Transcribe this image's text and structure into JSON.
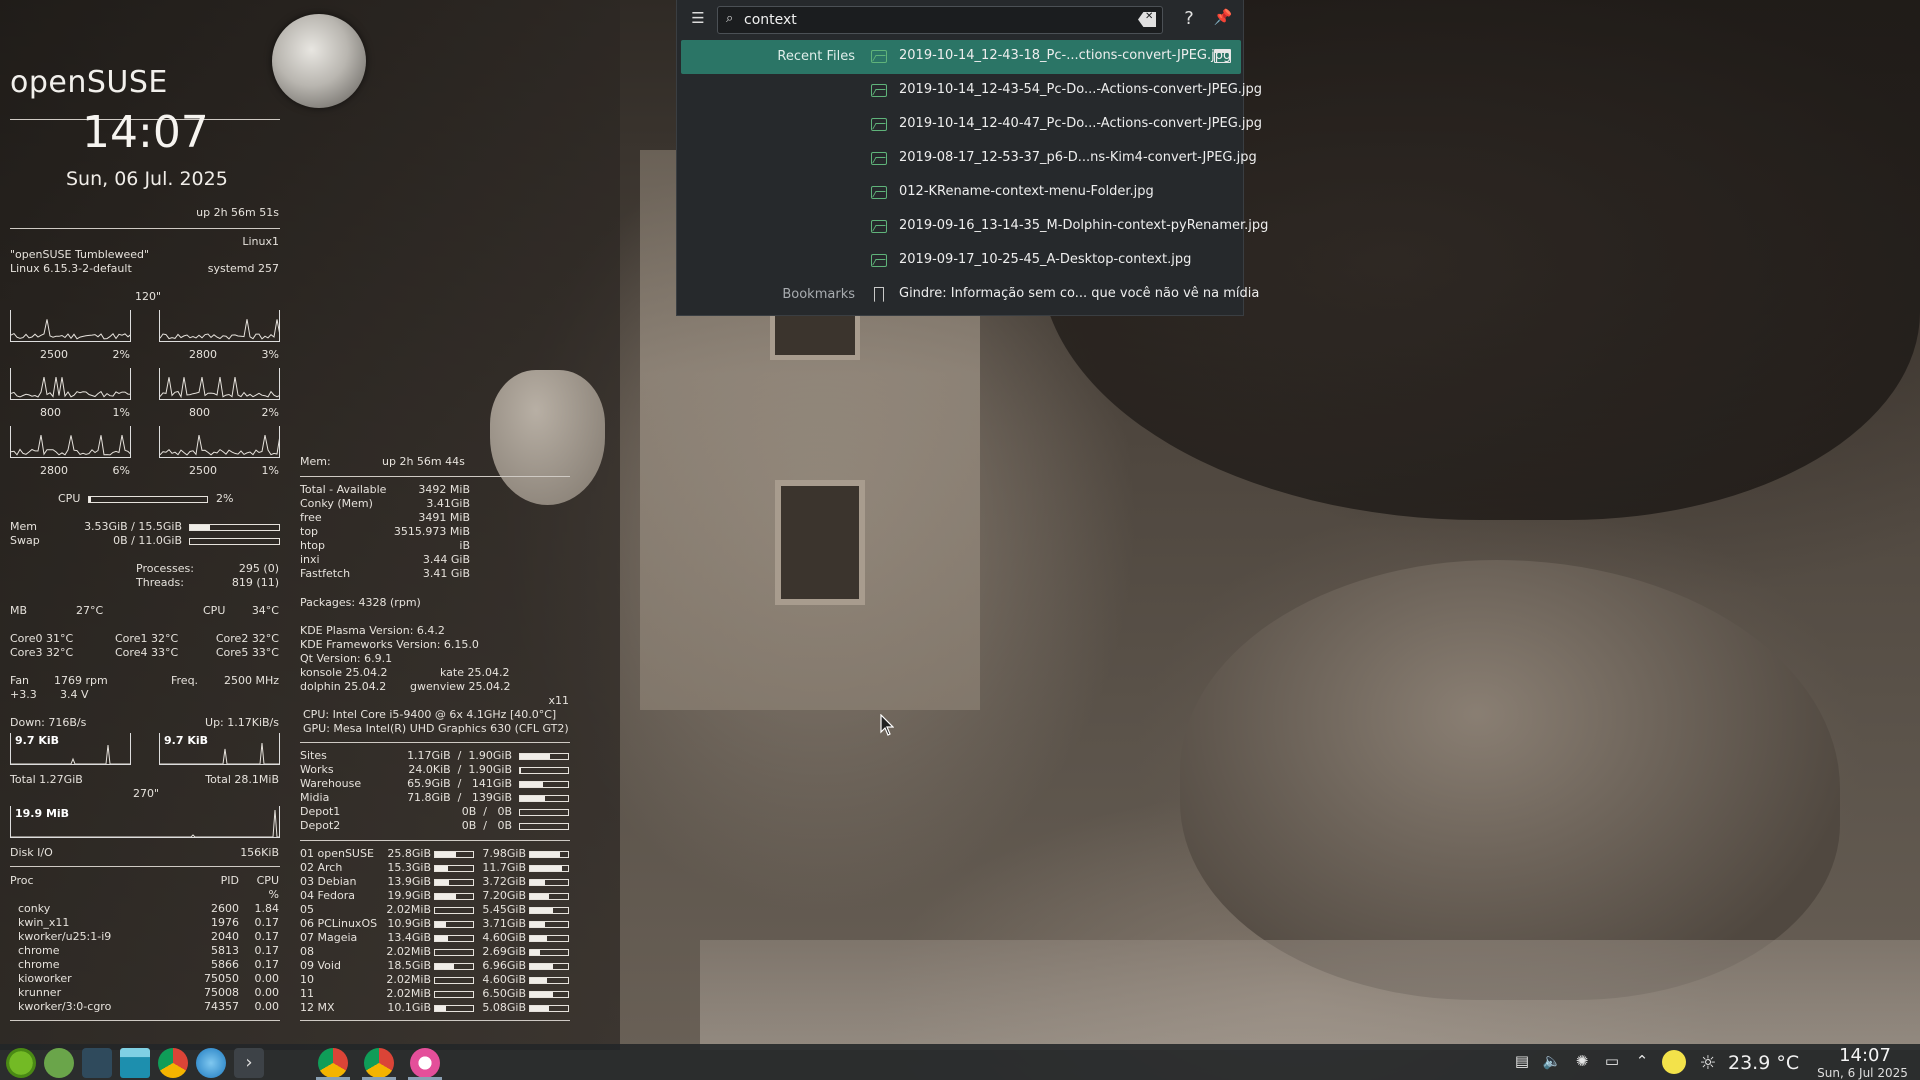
{
  "conky_left": {
    "distro": "openSUSE",
    "time": "14:07",
    "date": "Sun, 06 Jul. 2025",
    "uptime": "up  2h 56m 51s",
    "host": "Linux1",
    "os_name": "\"openSUSE Tumbleweed\"",
    "kernel": "Linux 6.15.3-2-default",
    "systemd": "systemd 257",
    "cpu_interval": "120\"",
    "cores": [
      {
        "freq": "2500",
        "usage": "2%"
      },
      {
        "freq": "2800",
        "usage": "3%"
      },
      {
        "freq": "800",
        "usage": "1%"
      },
      {
        "freq": "800",
        "usage": "2%"
      },
      {
        "freq": "2800",
        "usage": "6%"
      },
      {
        "freq": "2500",
        "usage": "1%"
      }
    ],
    "cpu_label": "CPU",
    "cpu_total": "2%",
    "cpu_fraction": 0.02,
    "mem_label": "Mem",
    "mem_value": "3.53GiB / 15.5GiB",
    "mem_fraction": 0.23,
    "swap_label": "Swap",
    "swap_value": "0B / 11.0GiB",
    "swap_fraction": 0.0,
    "processes_label": "Processes:",
    "processes": "295 (0)",
    "threads_label": "Threads:",
    "threads": "819 (11)",
    "mb_label": "MB",
    "mb_temp": "27°C",
    "cpu_temp_label": "CPU",
    "cpu_temp": "34°C",
    "core_temps": [
      "Core0  31°C",
      "Core1  32°C",
      "Core2  32°C",
      "Core3  32°C",
      "Core4  33°C",
      "Core5  33°C"
    ],
    "fan_label": "Fan",
    "fan": "1769 rpm",
    "freq_label": "Freq.",
    "freq": "2500   MHz",
    "volt_label": "+3.3",
    "volt": "3.4 V",
    "down": "Down: 716B/s",
    "up": "Up: 1.17KiB/s",
    "down_graph": "9.7 KiB",
    "up_graph": "9.7 KiB",
    "total_down": "Total 1.27GiB",
    "total_up": "Total 28.1MiB",
    "net_interval": "270\"",
    "disk_graph": "19.9 MiB",
    "disk_io_label": "Disk I/O",
    "disk_io": "156KiB",
    "proc_header": {
      "name": "Proc",
      "pid": "PID",
      "cpu": "CPU",
      "pct": "%"
    },
    "procs": [
      {
        "name": "conky",
        "pid": "2600",
        "cpu": "1.84"
      },
      {
        "name": "kwin_x11",
        "pid": "1976",
        "cpu": "0.17"
      },
      {
        "name": "kworker/u25:1-i9",
        "pid": "2040",
        "cpu": "0.17"
      },
      {
        "name": "chrome",
        "pid": "5813",
        "cpu": "0.17"
      },
      {
        "name": "chrome",
        "pid": "5866",
        "cpu": "0.17"
      },
      {
        "name": "kioworker",
        "pid": "75050",
        "cpu": "0.00"
      },
      {
        "name": "krunner",
        "pid": "75008",
        "cpu": "0.00"
      },
      {
        "name": "kworker/3:0-cgro",
        "pid": "74357",
        "cpu": "0.00"
      }
    ]
  },
  "conky_right": {
    "mem_label": "Mem:",
    "uptime": "up  2h 56m 44s",
    "mem_rows": [
      {
        "name": "Total - Available",
        "value": "3492 MiB"
      },
      {
        "name": "Conky (Mem)",
        "value": "3.41GiB"
      },
      {
        "name": "free",
        "value": "3491   MiB"
      },
      {
        "name": "top",
        "value": "3515.973  MiB"
      },
      {
        "name": "htop",
        "value": "iB"
      },
      {
        "name": "inxi",
        "value": "3.44 GiB"
      },
      {
        "name": "Fastfetch",
        "value": "3.41 GiB"
      }
    ],
    "packages": "Packages: 4328 (rpm)",
    "plasma": "KDE Plasma Version: 6.4.2",
    "frameworks": "KDE Frameworks Version: 6.15.0",
    "qt": "Qt Version: 6.9.1",
    "konsole": "konsole 25.04.2",
    "kate": "kate 25.04.2",
    "dolphin": "dolphin 25.04.2",
    "gwenview": "gwenview 25.04.2",
    "x11": "x11",
    "cpu_info": "CPU: Intel Core i5-9400 @ 6x 4.1GHz [40.0°C]",
    "gpu_info": "GPU: Mesa Intel(R) UHD Graphics 630 (CFL GT2)",
    "mounts": [
      {
        "name": "Sites",
        "value": "1.17GiB  /  1.90GiB",
        "fraction": 0.62
      },
      {
        "name": "Works",
        "value": "24.0KiB  /  1.90GiB",
        "fraction": 0.01
      },
      {
        "name": "Warehouse",
        "value": "65.9GiB  /   141GiB",
        "fraction": 0.47
      },
      {
        "name": "Midia",
        "value": "71.8GiB  /   139GiB",
        "fraction": 0.52
      },
      {
        "name": "Depot1",
        "value": "0B  /   0B",
        "fraction": 0.0
      },
      {
        "name": "Depot2",
        "value": "0B  /   0B",
        "fraction": 0.0
      }
    ],
    "partitions": [
      {
        "name": "01 openSUSE",
        "used": "25.8GiB",
        "used_fraction": 0.55,
        "free": "7.98GiB",
        "free_fraction": 0.8
      },
      {
        "name": "02 Arch",
        "used": "15.3GiB",
        "used_fraction": 0.35,
        "free": "11.7GiB",
        "free_fraction": 0.85
      },
      {
        "name": "03 Debian",
        "used": "13.9GiB",
        "used_fraction": 0.38,
        "free": "3.72GiB",
        "free_fraction": 0.4
      },
      {
        "name": "04 Fedora",
        "used": "19.9GiB",
        "used_fraction": 0.55,
        "free": "7.20GiB",
        "free_fraction": 0.5
      },
      {
        "name": "05",
        "used": "2.02MiB",
        "used_fraction": 0.0,
        "free": "5.45GiB",
        "free_fraction": 0.6
      },
      {
        "name": "06 PCLinuxOS",
        "used": "10.9GiB",
        "used_fraction": 0.3,
        "free": "3.71GiB",
        "free_fraction": 0.4
      },
      {
        "name": "07 Mageia",
        "used": "13.4GiB",
        "used_fraction": 0.35,
        "free": "4.60GiB",
        "free_fraction": 0.45
      },
      {
        "name": "08",
        "used": "2.02MiB",
        "used_fraction": 0.0,
        "free": "2.69GiB",
        "free_fraction": 0.25
      },
      {
        "name": "09 Void",
        "used": "18.5GiB",
        "used_fraction": 0.5,
        "free": "6.96GiB",
        "free_fraction": 0.6
      },
      {
        "name": "10",
        "used": "2.02MiB",
        "used_fraction": 0.0,
        "free": "4.60GiB",
        "free_fraction": 0.45
      },
      {
        "name": "11",
        "used": "2.02MiB",
        "used_fraction": 0.0,
        "free": "6.50GiB",
        "free_fraction": 0.6
      },
      {
        "name": "12 MX",
        "used": "10.1GiB",
        "used_fraction": 0.3,
        "free": "5.08GiB",
        "free_fraction": 0.5
      }
    ]
  },
  "krunner": {
    "query": "context",
    "results": [
      {
        "category": "Recent Files",
        "text": "2019-10-14_12-43-18_Pc-...ctions-convert-JPEG.jpg",
        "selected": true
      },
      {
        "category": "",
        "text": "2019-10-14_12-43-54_Pc-Do...-Actions-convert-JPEG.jpg",
        "selected": false
      },
      {
        "category": "",
        "text": "2019-10-14_12-40-47_Pc-Do...-Actions-convert-JPEG.jpg",
        "selected": false
      },
      {
        "category": "",
        "text": "2019-08-17_12-53-37_p6-D...ns-Kim4-convert-JPEG.jpg",
        "selected": false
      },
      {
        "category": "",
        "text": "012-KRename-context-menu-Folder.jpg",
        "selected": false
      },
      {
        "category": "",
        "text": "2019-09-16_13-14-35_M-Dolphin-context-pyRenamer.jpg",
        "selected": false
      },
      {
        "category": "",
        "text": "2019-09-17_10-25-45_A-Desktop-context.jpg",
        "selected": false
      },
      {
        "category": "Bookmarks",
        "text": "Gindre: Informação sem co... que você não vê na mídia",
        "selected": false
      }
    ]
  },
  "taskbar": {
    "temperature": "23.9 °C",
    "time": "14:07",
    "date": "Sun, 6 Jul 2025"
  },
  "colors": {
    "krunner_bg": "#26292c",
    "krunner_selected": "#2b7566",
    "file_icon": "#5fb37a",
    "taskbar_bg": "#222528"
  }
}
